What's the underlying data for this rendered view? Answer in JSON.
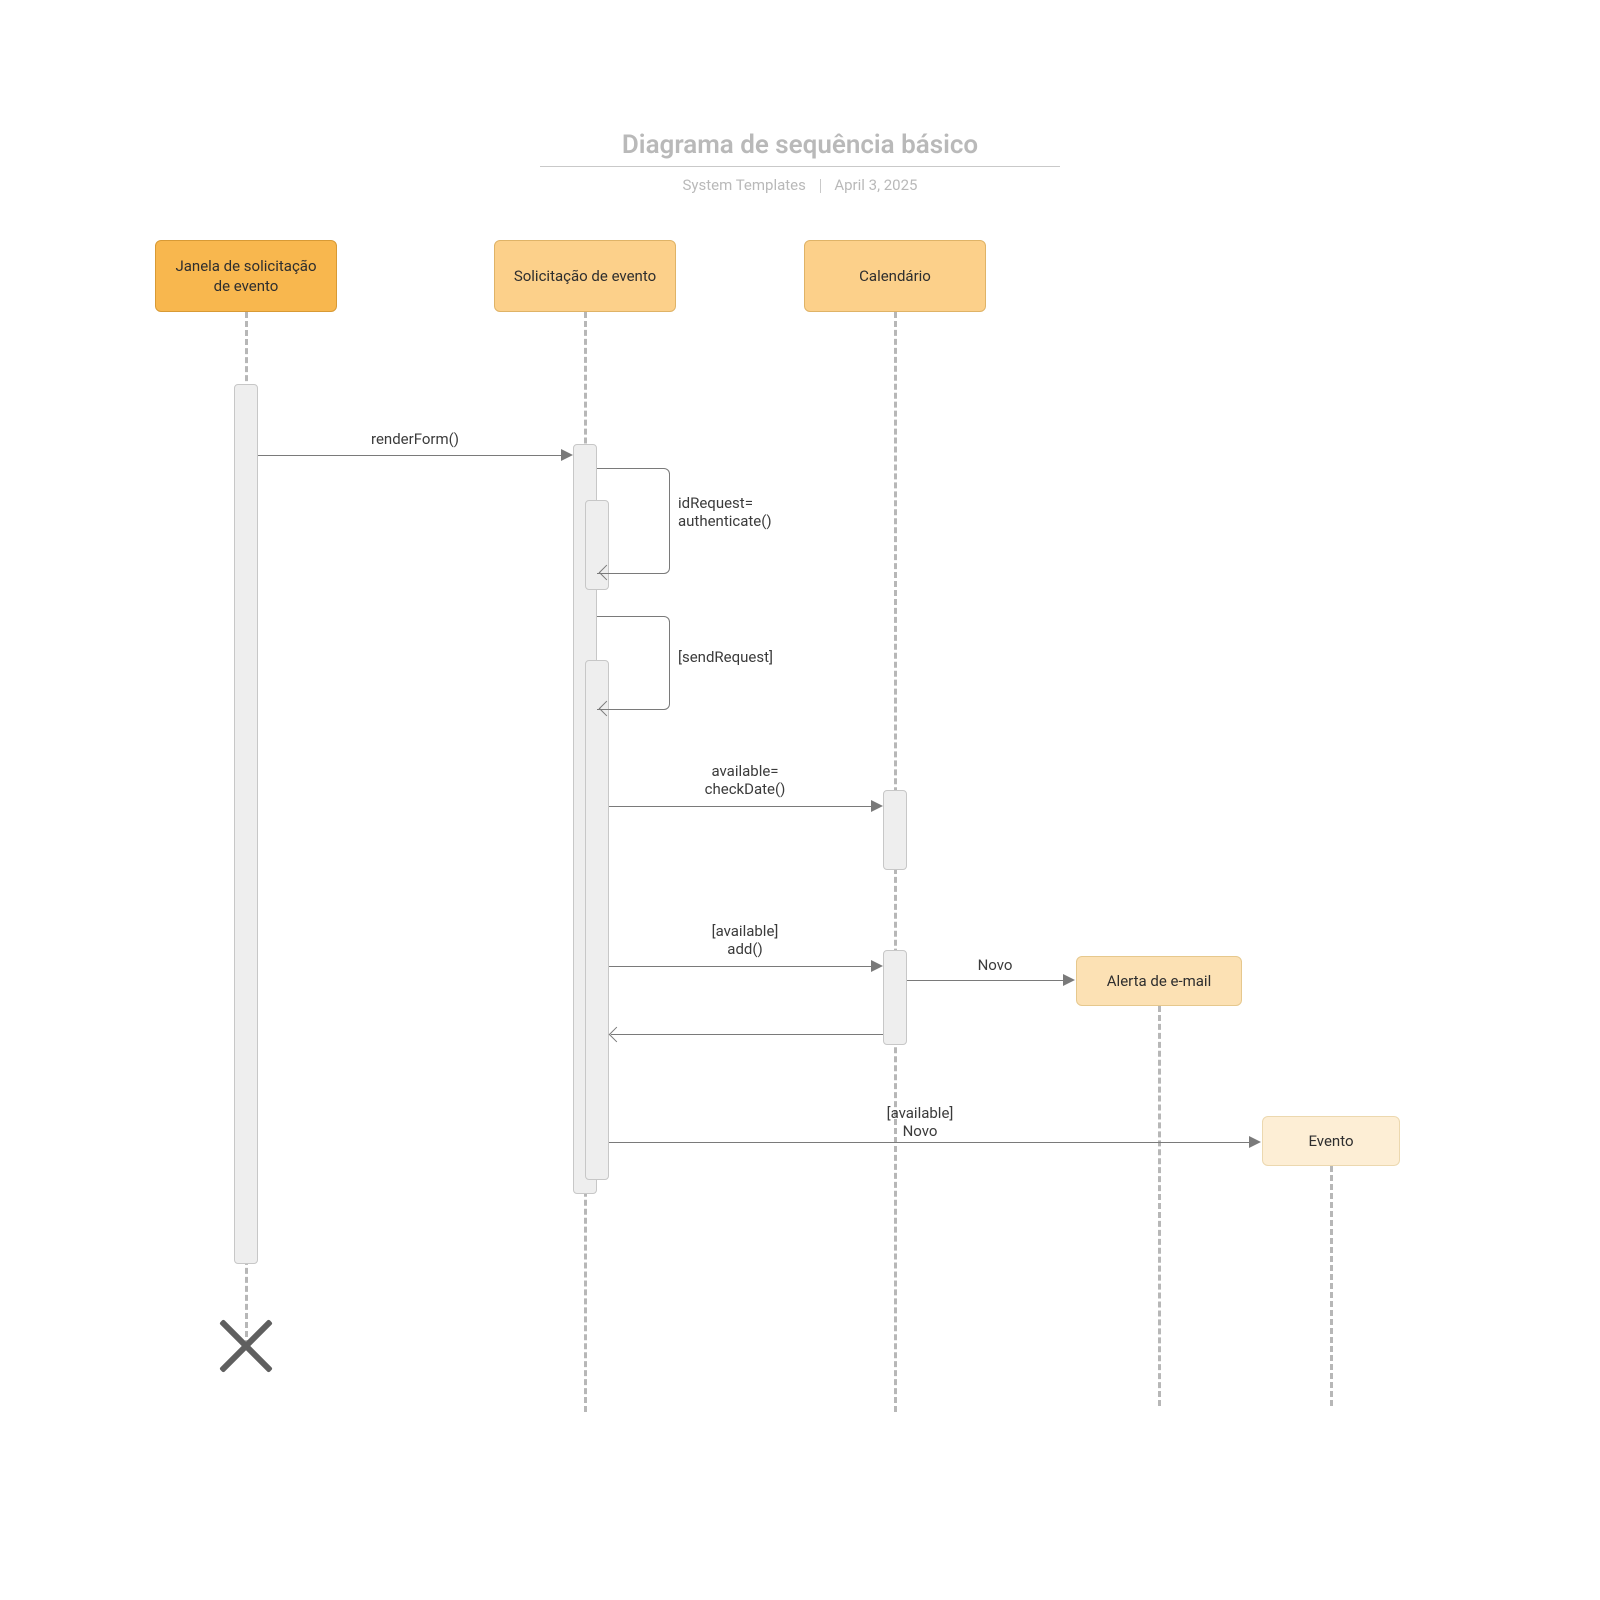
{
  "header": {
    "title": "Diagrama de sequência básico",
    "author": "System Templates",
    "date": "April 3, 2025"
  },
  "actors": {
    "a1": "Janela de solicitação de\nevento",
    "a2": "Solicitação de evento",
    "a3": "Calendário",
    "a4": "Alerta de e-mail",
    "a5": "Evento"
  },
  "messages": {
    "m1": "renderForm()",
    "m2": "idRequest=\nauthenticate()",
    "m3": "[sendRequest]",
    "m4": "available=\ncheckDate()",
    "m5": "[available]\nadd()",
    "m6": "Novo",
    "m7": "[available]\nNovo"
  },
  "chart_data": {
    "type": "uml-sequence",
    "title": "Diagrama de sequência básico",
    "participants": [
      {
        "id": "a1",
        "name": "Janela de solicitação de evento"
      },
      {
        "id": "a2",
        "name": "Solicitação de evento"
      },
      {
        "id": "a3",
        "name": "Calendário"
      },
      {
        "id": "a4",
        "name": "Alerta de e-mail",
        "created_by": "a3"
      },
      {
        "id": "a5",
        "name": "Evento",
        "created_by": "a2"
      }
    ],
    "messages": [
      {
        "from": "a1",
        "to": "a2",
        "label": "renderForm()",
        "type": "sync"
      },
      {
        "from": "a2",
        "to": "a2",
        "label": "idRequest= authenticate()",
        "type": "self"
      },
      {
        "from": "a2",
        "to": "a2",
        "label": "[sendRequest]",
        "type": "self"
      },
      {
        "from": "a2",
        "to": "a3",
        "label": "available= checkDate()",
        "type": "sync"
      },
      {
        "from": "a2",
        "to": "a3",
        "label": "[available] add()",
        "type": "sync"
      },
      {
        "from": "a3",
        "to": "a4",
        "label": "Novo",
        "type": "create"
      },
      {
        "from": "a3",
        "to": "a2",
        "label": "",
        "type": "return"
      },
      {
        "from": "a2",
        "to": "a5",
        "label": "[available] Novo",
        "type": "create"
      }
    ],
    "destructions": [
      "a1"
    ]
  }
}
